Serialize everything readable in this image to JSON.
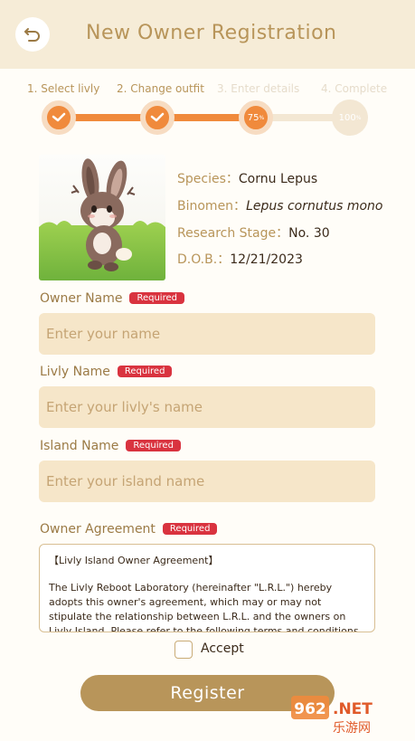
{
  "header": {
    "title": "New Owner Registration"
  },
  "steps": [
    {
      "label": "1. Select livly",
      "state": "done"
    },
    {
      "label": "2. Change outfit",
      "state": "done"
    },
    {
      "label": "3. Enter details",
      "state": "current"
    },
    {
      "label": "4. Complete",
      "state": "todo"
    }
  ],
  "progress": {
    "current_percent": "75",
    "final_percent": "100",
    "unit": "%"
  },
  "pet_info": {
    "species_label": "Species：",
    "species": "Cornu Lepus",
    "binomen_label": "Binomen：",
    "binomen": "Lepus cornutus mono",
    "stage_label": "Research Stage：",
    "stage": "No. 30",
    "dob_label": "D.O.B.：",
    "dob": "12/21/2023"
  },
  "form": {
    "owner_name": {
      "label": "Owner Name",
      "required": "Required",
      "placeholder": "Enter your name"
    },
    "livly_name": {
      "label": "Livly Name",
      "required": "Required",
      "placeholder": "Enter your livly's name"
    },
    "island_name": {
      "label": "Island Name",
      "required": "Required",
      "placeholder": "Enter your island name"
    },
    "agreement": {
      "label": "Owner Agreement",
      "required": "Required",
      "title": "【Livly Island Owner Agreement】",
      "body": "The Livly Reboot Laboratory (hereinafter \"L.R.L.\") hereby adopts this owner's agreement, which may or may not stipulate the relationship between L.R.L. and the owners on Livly Island. Please refer to the following terms and conditions."
    },
    "accept_label": "Accept",
    "register_label": "Register"
  },
  "watermark": {
    "number": "962",
    "suffix": ".NET",
    "site": "乐游网"
  },
  "colors": {
    "accent": "#f08a3c",
    "brand": "#b8955a",
    "required": "#d9333f"
  }
}
